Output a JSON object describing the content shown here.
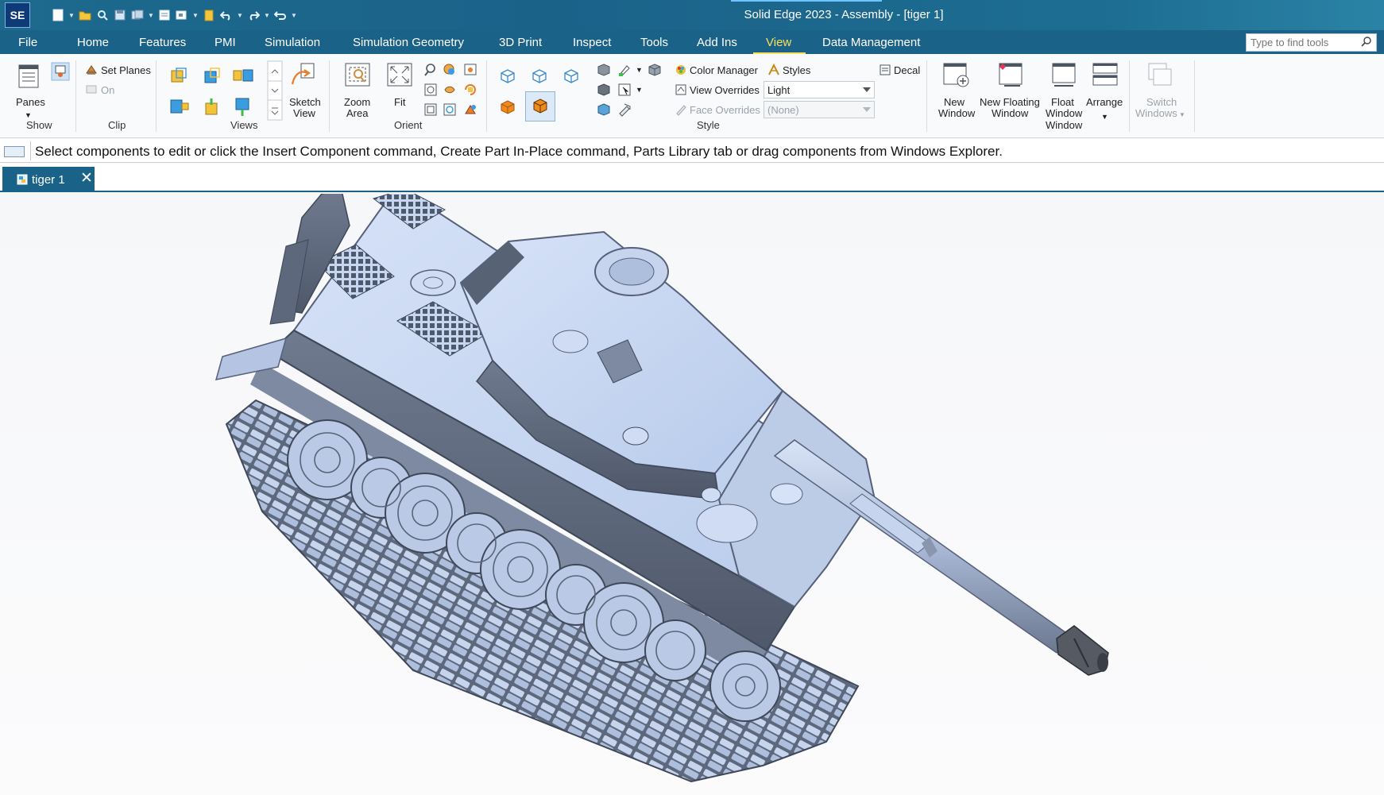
{
  "titlebar": {
    "logo": "SE",
    "title": "Solid Edge 2023 - Assembly - [tiger 1]",
    "qat_icons": [
      "new-icon",
      "open-icon",
      "find-icon",
      "save-icon",
      "save-as-icon",
      "properties-icon",
      "view-icon",
      "paste-icon",
      "undo-icon",
      "redo-icon",
      "reload-icon",
      "customize-icon"
    ]
  },
  "menu": {
    "file": "File",
    "tabs": [
      "Home",
      "Features",
      "PMI",
      "Simulation",
      "Simulation Geometry",
      "3D Print",
      "Inspect",
      "Tools",
      "Add Ins",
      "View",
      "Data Management"
    ],
    "active": "View",
    "find_placeholder": "Type to find tools"
  },
  "ribbon": {
    "show": {
      "panes": "Panes",
      "label": "Show"
    },
    "clip": {
      "set_planes": "Set Planes",
      "on": "On",
      "label": "Clip"
    },
    "views": {
      "sketch_view": "Sketch",
      "sketch_view_2": "View",
      "label": "Views"
    },
    "orient": {
      "zoom_area": "Zoom",
      "zoom_area_2": "Area",
      "fit": "Fit",
      "label": "Orient"
    },
    "style": {
      "color_manager": "Color Manager",
      "styles": "Styles",
      "decal": "Decal",
      "view_overrides": "View Overrides",
      "view_overrides_value": "Light",
      "face_overrides": "Face Overrides",
      "face_overrides_value": "(None)",
      "label": "Style"
    },
    "window": {
      "new_window": [
        "New",
        "Window"
      ],
      "new_floating_window": [
        "New Floating",
        "Window"
      ],
      "float_window": [
        "Float",
        "Window",
        "Window"
      ],
      "arrange": "Arrange",
      "switch_windows": [
        "Switch",
        "Windows"
      ]
    }
  },
  "prompt": {
    "text": "Select components to edit or click the Insert Component command, Create Part In-Place command, Parts Library tab or drag components from Windows Explorer."
  },
  "document": {
    "tab_label": "tiger 1",
    "close": "✕"
  },
  "colors": {
    "title_bg": "#1b6289",
    "active_tab": "#f6e25a",
    "model_light": "#c7d7f3",
    "model_dark": "#5f6a7f"
  }
}
